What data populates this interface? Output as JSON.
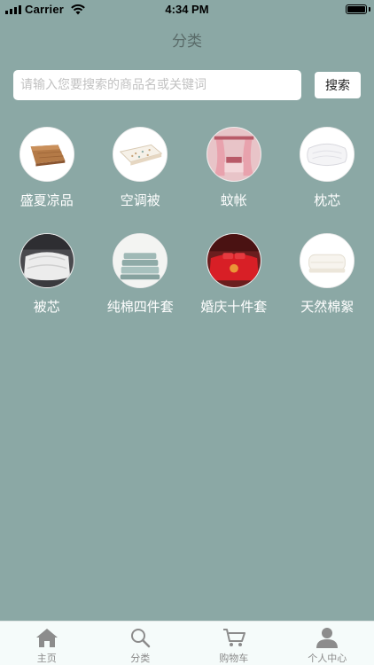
{
  "status_bar": {
    "carrier": "Carrier",
    "time": "4:34 PM"
  },
  "nav": {
    "title": "分类"
  },
  "search": {
    "placeholder": "请输入您要搜索的商品名或关键词",
    "button_label": "搜索"
  },
  "categories": [
    {
      "label": "盛夏凉品",
      "icon": "bamboo-mat-icon"
    },
    {
      "label": "空调被",
      "icon": "quilt-icon"
    },
    {
      "label": "蚊帐",
      "icon": "mosquito-net-icon"
    },
    {
      "label": "枕芯",
      "icon": "pillow-icon"
    },
    {
      "label": "被芯",
      "icon": "duvet-icon"
    },
    {
      "label": "纯棉四件套",
      "icon": "folded-bedding-icon"
    },
    {
      "label": "婚庆十件套",
      "icon": "wedding-bedding-icon"
    },
    {
      "label": "天然棉絮",
      "icon": "cotton-wadding-icon"
    }
  ],
  "tabbar": [
    {
      "label": "主页",
      "icon": "home-icon"
    },
    {
      "label": "分类",
      "icon": "search-icon"
    },
    {
      "label": "购物车",
      "icon": "cart-icon"
    },
    {
      "label": "个人中心",
      "icon": "person-icon"
    }
  ],
  "colors": {
    "background": "#8ba8a5",
    "tabbar_bg": "#f5fbfa",
    "tab_inactive": "#8a8a8a"
  }
}
